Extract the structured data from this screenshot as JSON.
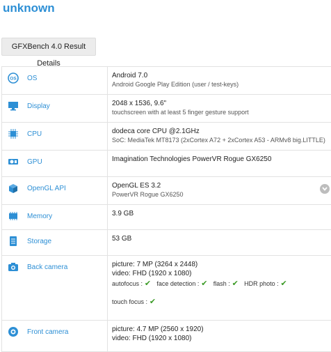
{
  "header": {
    "title": "unknown",
    "tab_label": "GFXBench 4.0 Result Details"
  },
  "colors": {
    "accent": "#2d8fd5",
    "check": "#3a9a25"
  },
  "rows": [
    {
      "id": "os",
      "icon": "os-icon",
      "label": "OS",
      "main": "Android 7.0",
      "sub": "Android Google Play Edition (user / test-keys)"
    },
    {
      "id": "display",
      "icon": "display-icon",
      "label": "Display",
      "main": "2048 x 1536, 9.6\"",
      "sub": "touchscreen with at least 5 finger gesture support"
    },
    {
      "id": "cpu",
      "icon": "cpu-icon",
      "label": "CPU",
      "main": "dodeca core CPU @2.1GHz",
      "sub": "SoC: MediaTek MT8173 (2xCortex A72 + 2xCortex A53 - ARMv8 big.LITTLE)"
    },
    {
      "id": "gpu",
      "icon": "gpu-icon",
      "label": "GPU",
      "main": "Imagination Technologies PowerVR Rogue GX6250",
      "sub": ""
    },
    {
      "id": "opengl",
      "icon": "opengl-icon",
      "label": "OpenGL API",
      "main": "OpenGL ES 3.2",
      "sub": "PowerVR Rogue GX6250"
    },
    {
      "id": "memory",
      "icon": "memory-icon",
      "label": "Memory",
      "main": "3.9 GB",
      "sub": ""
    },
    {
      "id": "storage",
      "icon": "storage-icon",
      "label": "Storage",
      "main": "53 GB",
      "sub": ""
    },
    {
      "id": "back_camera",
      "icon": "camera-icon",
      "label": "Back camera",
      "main": "picture: 7 MP (3264 x 2448)",
      "main2": "video: FHD (1920 x 1080)",
      "features": [
        "autofocus :",
        "face detection :",
        "flash :",
        "HDR photo :"
      ],
      "features2": [
        "touch focus :"
      ]
    },
    {
      "id": "front_camera",
      "icon": "front-camera-icon",
      "label": "Front camera",
      "main": "picture: 4.7 MP (2560 x 1920)",
      "main2": "video: FHD (1920 x 1080)"
    }
  ]
}
